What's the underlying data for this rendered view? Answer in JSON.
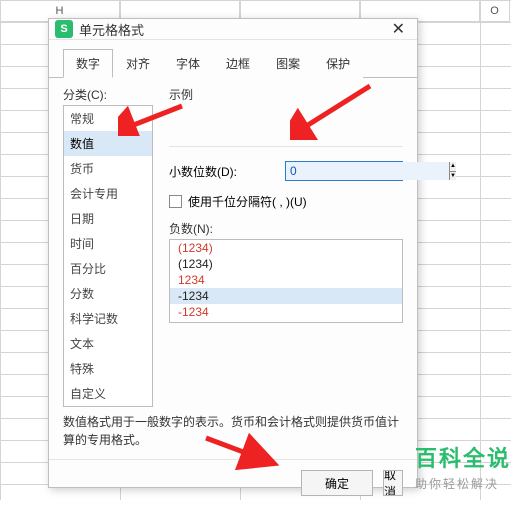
{
  "columns": [
    "H",
    "",
    "",
    "",
    "O"
  ],
  "dialog": {
    "title": "单元格格式",
    "tabs": [
      "数字",
      "对齐",
      "字体",
      "边框",
      "图案",
      "保护"
    ],
    "active_tab": 0,
    "category_label": "分类(C):",
    "categories": [
      "常规",
      "数值",
      "货币",
      "会计专用",
      "日期",
      "时间",
      "百分比",
      "分数",
      "科学记数",
      "文本",
      "特殊",
      "自定义"
    ],
    "selected_category": 1,
    "example_label": "示例",
    "decimal_label": "小数位数(D):",
    "decimal_value": "0",
    "thousands_label": "使用千位分隔符( , )(U)",
    "negatives_label": "负数(N):",
    "negatives": [
      {
        "text": "(1234)",
        "cls": "neg-red"
      },
      {
        "text": "(1234)",
        "cls": "neg-black"
      },
      {
        "text": "1234",
        "cls": "neg-red"
      },
      {
        "text": "-1234",
        "cls": "neg-black"
      },
      {
        "text": "-1234",
        "cls": "neg-red"
      }
    ],
    "neg_selected": 3,
    "hint": "数值格式用于一般数字的表示。货币和会计格式则提供货币值计算的专用格式。",
    "ok": "确定",
    "cancel": "取消"
  },
  "watermark": {
    "big": "百科全说",
    "small": "助你轻松解决"
  }
}
